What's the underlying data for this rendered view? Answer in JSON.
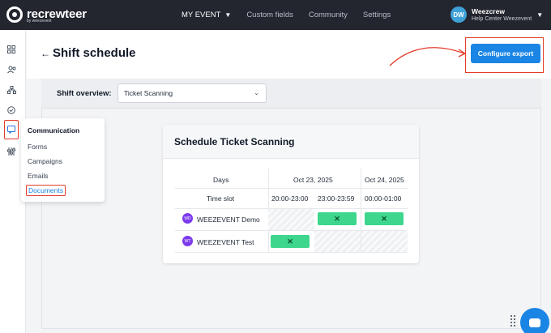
{
  "topbar": {
    "brand": "recrewteer",
    "brand_sub": "by weezevent",
    "nav": [
      {
        "label": "MY EVENT",
        "has_chevron": true
      },
      {
        "label": "Custom fields"
      },
      {
        "label": "Community"
      },
      {
        "label": "Settings"
      }
    ],
    "user": {
      "initials": "DW",
      "name": "Weezcrew",
      "subtitle": "Help Center Weezevent"
    }
  },
  "sidebar": {
    "icons": [
      "dashboard-icon",
      "users-icon",
      "org-chart-icon",
      "check-circle-icon",
      "communication-icon",
      "sliders-icon"
    ],
    "active": "communication-icon"
  },
  "header": {
    "back_icon": "arrow-left-icon",
    "title": "Shift schedule",
    "export_label": "Configure export"
  },
  "filter": {
    "label": "Shift overview:",
    "selected": "Ticket Scanning"
  },
  "flyout": {
    "title": "Communication",
    "items": [
      "Forms",
      "Campaigns",
      "Emails",
      "Documents"
    ],
    "active": "Documents"
  },
  "schedule": {
    "title": "Schedule Ticket Scanning",
    "days_label": "Days",
    "timeslot_label": "Time slot",
    "days": [
      "Oct 23, 2025",
      "Oct 24, 2025"
    ],
    "slots": [
      "20:00-23:00",
      "23:00-23:59",
      "00:00-01:00"
    ],
    "rows": [
      {
        "initials": "WD",
        "name": "WEEZEVENT Demo",
        "cells": [
          "empty",
          "assigned",
          "assigned"
        ],
        "mark": "✕"
      },
      {
        "initials": "WT",
        "name": "WEEZEVENT Test",
        "cells": [
          "assigned",
          "empty",
          "empty"
        ],
        "mark": "✕"
      }
    ]
  },
  "colors": {
    "topbar": "#23262f",
    "primary": "#1a85e5",
    "assigned": "#3dd68c",
    "highlight": "#e53c2a",
    "row_avatar": "#7c3aed"
  }
}
